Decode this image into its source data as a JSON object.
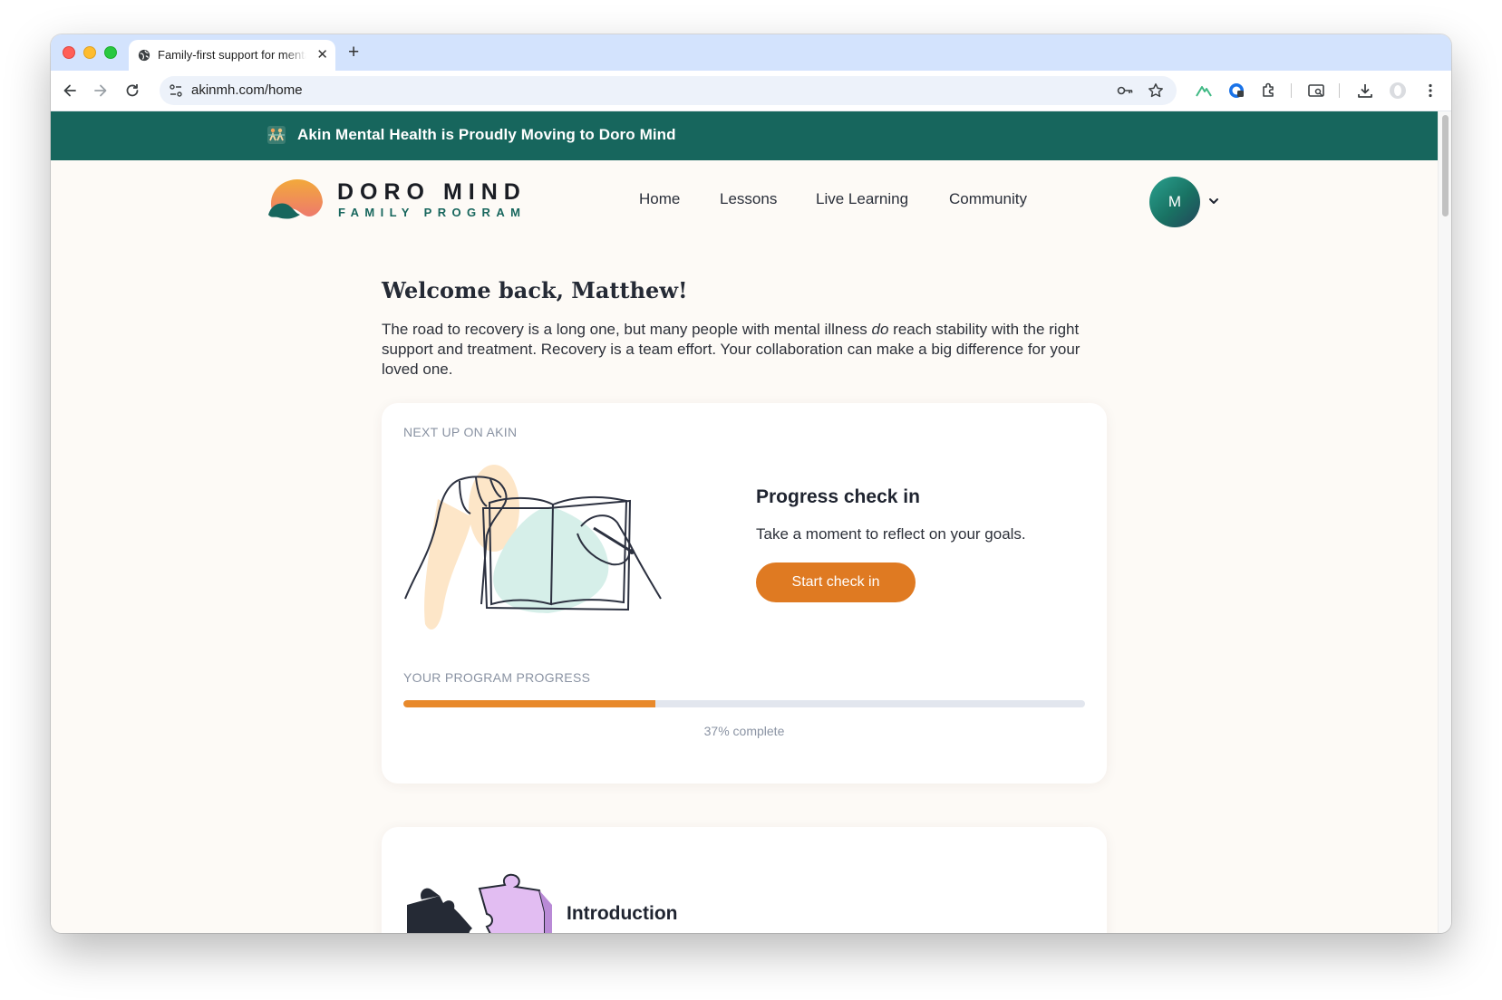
{
  "browser": {
    "tab_title": "Family-first support for mental health",
    "url": "akinmh.com/home",
    "new_tab_symbol": "+",
    "close_symbol": "✕"
  },
  "banner": {
    "text": "Akin Mental Health is Proudly Moving to Doro Mind"
  },
  "header": {
    "logo_line1": "DORO MIND",
    "logo_line2": "FAMILY PROGRAM",
    "nav": [
      "Home",
      "Lessons",
      "Live Learning",
      "Community"
    ],
    "avatar_initial": "M"
  },
  "main": {
    "welcome": "Welcome back, Matthew!",
    "intro_part1": "The road to recovery is a long one, but many people with mental illness ",
    "intro_emphasis": "do",
    "intro_part2": " reach stability with the right support and treatment. Recovery is a team effort. Your collaboration can make a big difference for your loved one."
  },
  "next_up": {
    "eyebrow": "NEXT UP ON AKIN",
    "title": "Progress check in",
    "description": "Take a moment to reflect on your goals.",
    "button": "Start check in"
  },
  "progress": {
    "label": "YOUR PROGRAM PROGRESS",
    "percent": 37,
    "text": "37% complete"
  },
  "lesson_card": {
    "title": "Introduction"
  },
  "colors": {
    "brand_teal": "#17665d",
    "accent_orange": "#df7a22",
    "page_bg": "#fdfaf6"
  }
}
